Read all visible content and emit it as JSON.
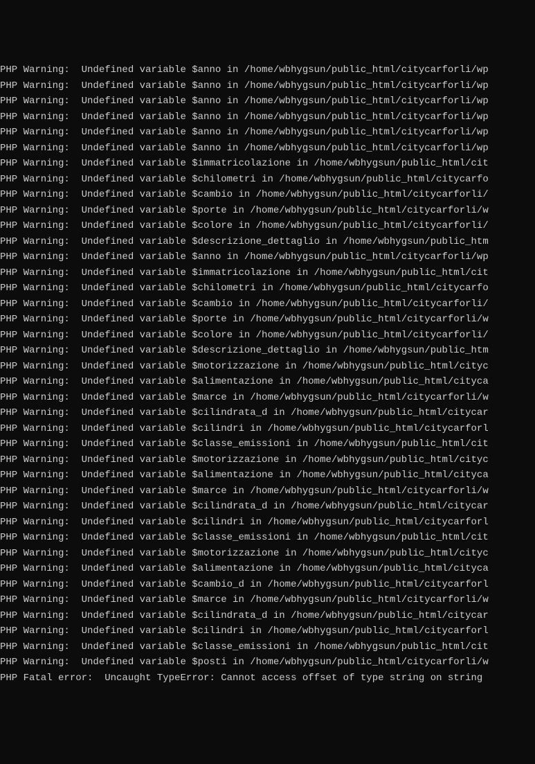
{
  "log": {
    "lines": [
      "PHP Warning:  Undefined variable $anno in /home/wbhygsun/public_html/citycarforli/wp",
      "PHP Warning:  Undefined variable $anno in /home/wbhygsun/public_html/citycarforli/wp",
      "PHP Warning:  Undefined variable $anno in /home/wbhygsun/public_html/citycarforli/wp",
      "PHP Warning:  Undefined variable $anno in /home/wbhygsun/public_html/citycarforli/wp",
      "PHP Warning:  Undefined variable $anno in /home/wbhygsun/public_html/citycarforli/wp",
      "PHP Warning:  Undefined variable $anno in /home/wbhygsun/public_html/citycarforli/wp",
      "PHP Warning:  Undefined variable $immatricolazione in /home/wbhygsun/public_html/cit",
      "PHP Warning:  Undefined variable $chilometri in /home/wbhygsun/public_html/citycarfo",
      "PHP Warning:  Undefined variable $cambio in /home/wbhygsun/public_html/citycarforli/",
      "PHP Warning:  Undefined variable $porte in /home/wbhygsun/public_html/citycarforli/w",
      "PHP Warning:  Undefined variable $colore in /home/wbhygsun/public_html/citycarforli/",
      "PHP Warning:  Undefined variable $descrizione_dettaglio in /home/wbhygsun/public_htm",
      "PHP Warning:  Undefined variable $anno in /home/wbhygsun/public_html/citycarforli/wp",
      "PHP Warning:  Undefined variable $immatricolazione in /home/wbhygsun/public_html/cit",
      "PHP Warning:  Undefined variable $chilometri in /home/wbhygsun/public_html/citycarfo",
      "PHP Warning:  Undefined variable $cambio in /home/wbhygsun/public_html/citycarforli/",
      "PHP Warning:  Undefined variable $porte in /home/wbhygsun/public_html/citycarforli/w",
      "PHP Warning:  Undefined variable $colore in /home/wbhygsun/public_html/citycarforli/",
      "PHP Warning:  Undefined variable $descrizione_dettaglio in /home/wbhygsun/public_htm",
      "PHP Warning:  Undefined variable $motorizzazione in /home/wbhygsun/public_html/cityc",
      "PHP Warning:  Undefined variable $alimentazione in /home/wbhygsun/public_html/cityca",
      "PHP Warning:  Undefined variable $marce in /home/wbhygsun/public_html/citycarforli/w",
      "PHP Warning:  Undefined variable $cilindrata_d in /home/wbhygsun/public_html/citycar",
      "PHP Warning:  Undefined variable $cilindri in /home/wbhygsun/public_html/citycarforl",
      "PHP Warning:  Undefined variable $classe_emissioni in /home/wbhygsun/public_html/cit",
      "PHP Warning:  Undefined variable $motorizzazione in /home/wbhygsun/public_html/cityc",
      "PHP Warning:  Undefined variable $alimentazione in /home/wbhygsun/public_html/cityca",
      "PHP Warning:  Undefined variable $marce in /home/wbhygsun/public_html/citycarforli/w",
      "PHP Warning:  Undefined variable $cilindrata_d in /home/wbhygsun/public_html/citycar",
      "PHP Warning:  Undefined variable $cilindri in /home/wbhygsun/public_html/citycarforl",
      "PHP Warning:  Undefined variable $classe_emissioni in /home/wbhygsun/public_html/cit",
      "PHP Warning:  Undefined variable $motorizzazione in /home/wbhygsun/public_html/cityc",
      "PHP Warning:  Undefined variable $alimentazione in /home/wbhygsun/public_html/cityca",
      "PHP Warning:  Undefined variable $cambio_d in /home/wbhygsun/public_html/citycarforl",
      "PHP Warning:  Undefined variable $marce in /home/wbhygsun/public_html/citycarforli/w",
      "PHP Warning:  Undefined variable $cilindrata_d in /home/wbhygsun/public_html/citycar",
      "PHP Warning:  Undefined variable $cilindri in /home/wbhygsun/public_html/citycarforl",
      "PHP Warning:  Undefined variable $classe_emissioni in /home/wbhygsun/public_html/cit",
      "PHP Warning:  Undefined variable $posti in /home/wbhygsun/public_html/citycarforli/w",
      "PHP Fatal error:  Uncaught TypeError: Cannot access offset of type string on string "
    ]
  }
}
